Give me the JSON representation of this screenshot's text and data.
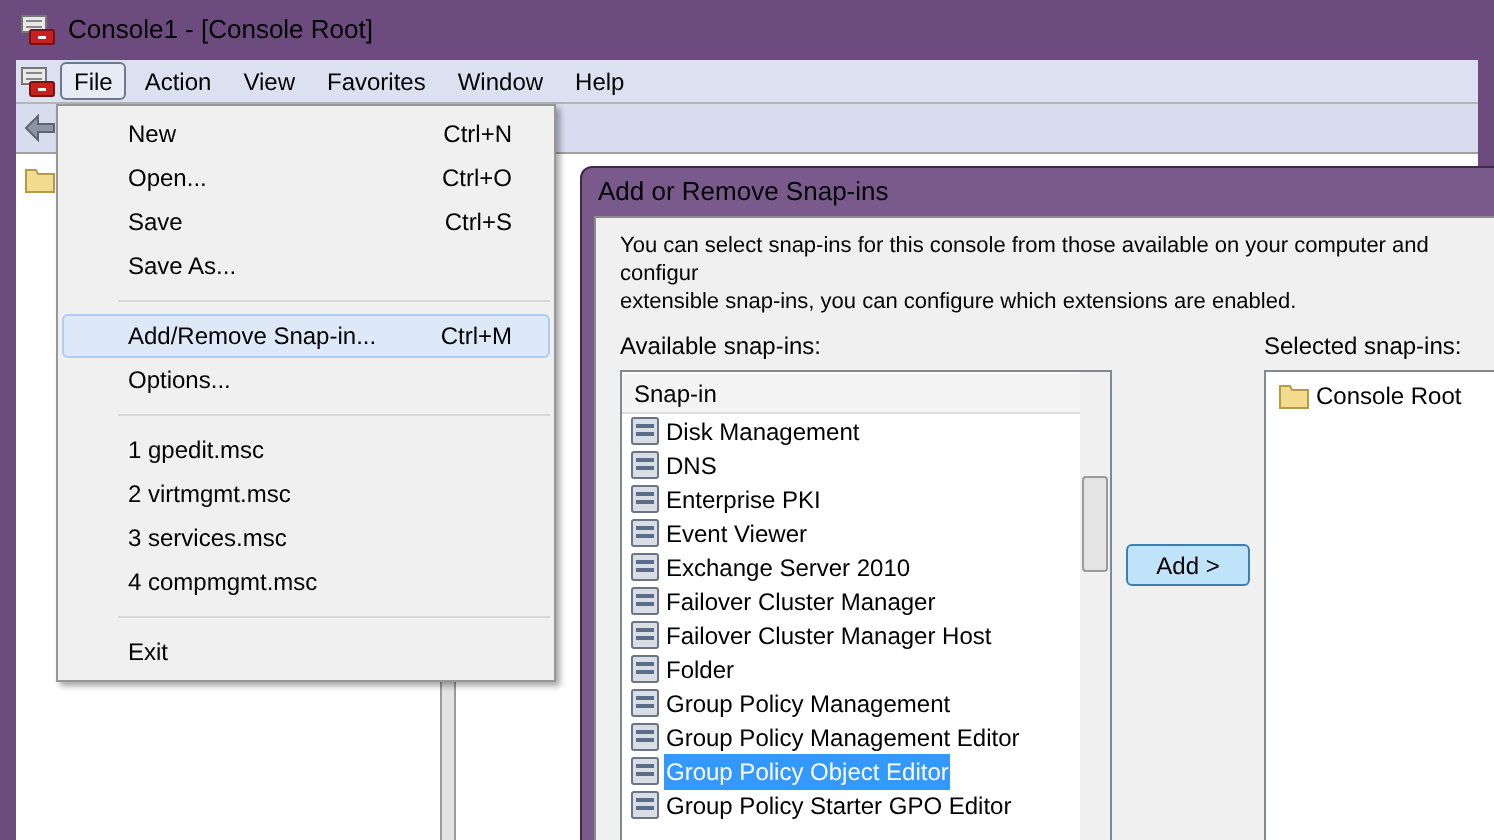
{
  "window": {
    "title": "Console1 - [Console Root]"
  },
  "menubar": [
    {
      "label": "File",
      "selected": true
    },
    {
      "label": "Action",
      "selected": false
    },
    {
      "label": "View",
      "selected": false
    },
    {
      "label": "Favorites",
      "selected": false
    },
    {
      "label": "Window",
      "selected": false
    },
    {
      "label": "Help",
      "selected": false
    }
  ],
  "file_menu": [
    {
      "kind": "item",
      "label": "New",
      "shortcut": "Ctrl+N",
      "selected": false
    },
    {
      "kind": "item",
      "label": "Open...",
      "shortcut": "Ctrl+O",
      "selected": false
    },
    {
      "kind": "item",
      "label": "Save",
      "shortcut": "Ctrl+S",
      "selected": false
    },
    {
      "kind": "item",
      "label": "Save As...",
      "selected": false
    },
    {
      "kind": "separator"
    },
    {
      "kind": "item",
      "label": "Add/Remove Snap-in...",
      "shortcut": "Ctrl+M",
      "selected": true
    },
    {
      "kind": "item",
      "label": "Options...",
      "selected": false
    },
    {
      "kind": "separator"
    },
    {
      "kind": "item",
      "label": "1 gpedit.msc",
      "selected": false
    },
    {
      "kind": "item",
      "label": "2 virtmgmt.msc",
      "selected": false
    },
    {
      "kind": "item",
      "label": "3 services.msc",
      "selected": false
    },
    {
      "kind": "item",
      "label": "4 compmgmt.msc",
      "selected": false
    },
    {
      "kind": "separator"
    },
    {
      "kind": "item",
      "label": "Exit",
      "selected": false
    }
  ],
  "dialog": {
    "title": "Add or Remove Snap-ins",
    "description": [
      "You can select snap-ins for this console from those available on your computer and configur",
      "extensible snap-ins, you can configure which extensions are enabled."
    ],
    "available_label": "Available snap-ins:",
    "list_header": "Snap-in",
    "available": [
      {
        "label": "Disk Management",
        "selected": false
      },
      {
        "label": "DNS",
        "selected": false
      },
      {
        "label": "Enterprise PKI",
        "selected": false
      },
      {
        "label": "Event Viewer",
        "selected": false
      },
      {
        "label": "Exchange Server 2010",
        "selected": false
      },
      {
        "label": "Failover Cluster Manager",
        "selected": false
      },
      {
        "label": "Failover Cluster Manager Host",
        "selected": false
      },
      {
        "label": "Folder",
        "selected": false
      },
      {
        "label": "Group Policy Management",
        "selected": false
      },
      {
        "label": "Group Policy Management Editor",
        "selected": false
      },
      {
        "label": "Group Policy Object Editor",
        "selected": true
      },
      {
        "label": "Group Policy Starter GPO Editor",
        "selected": false
      }
    ],
    "add_button": "Add >",
    "selected_label": "Selected snap-ins:",
    "selected_items": [
      "Console Root"
    ]
  }
}
